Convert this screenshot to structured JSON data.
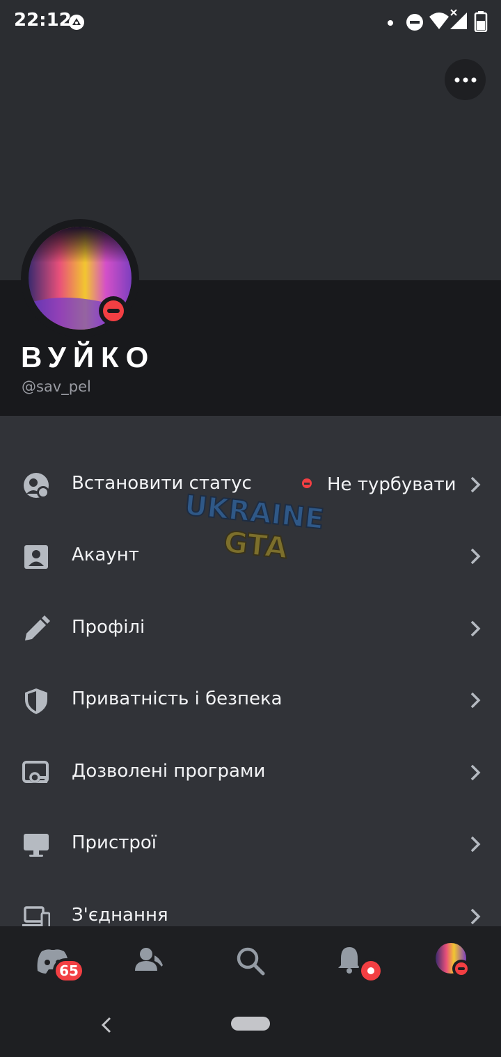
{
  "status_bar": {
    "time": "22:12"
  },
  "profile": {
    "display_name": "ВУЙКО",
    "username": "@sav_pel"
  },
  "watermark": {
    "line1": "UKRAINE",
    "line2": "GTA"
  },
  "settings": [
    {
      "label": "Встановити статус",
      "icon": "status-icon",
      "value": "Не турбувати"
    },
    {
      "label": "Акаунт",
      "icon": "account-icon"
    },
    {
      "label": "Профілі",
      "icon": "pencil-icon"
    },
    {
      "label": "Приватність і безпека",
      "icon": "shield-icon"
    },
    {
      "label": "Дозволені програми",
      "icon": "apps-key-icon"
    },
    {
      "label": "Пристрої",
      "icon": "monitor-icon"
    },
    {
      "label": "З'єднання",
      "icon": "devices-icon"
    }
  ],
  "bottom_nav": {
    "home_badge": "65"
  },
  "colors": {
    "accent_red": "#f23f43",
    "background": "#313338",
    "header": "#18191c"
  }
}
